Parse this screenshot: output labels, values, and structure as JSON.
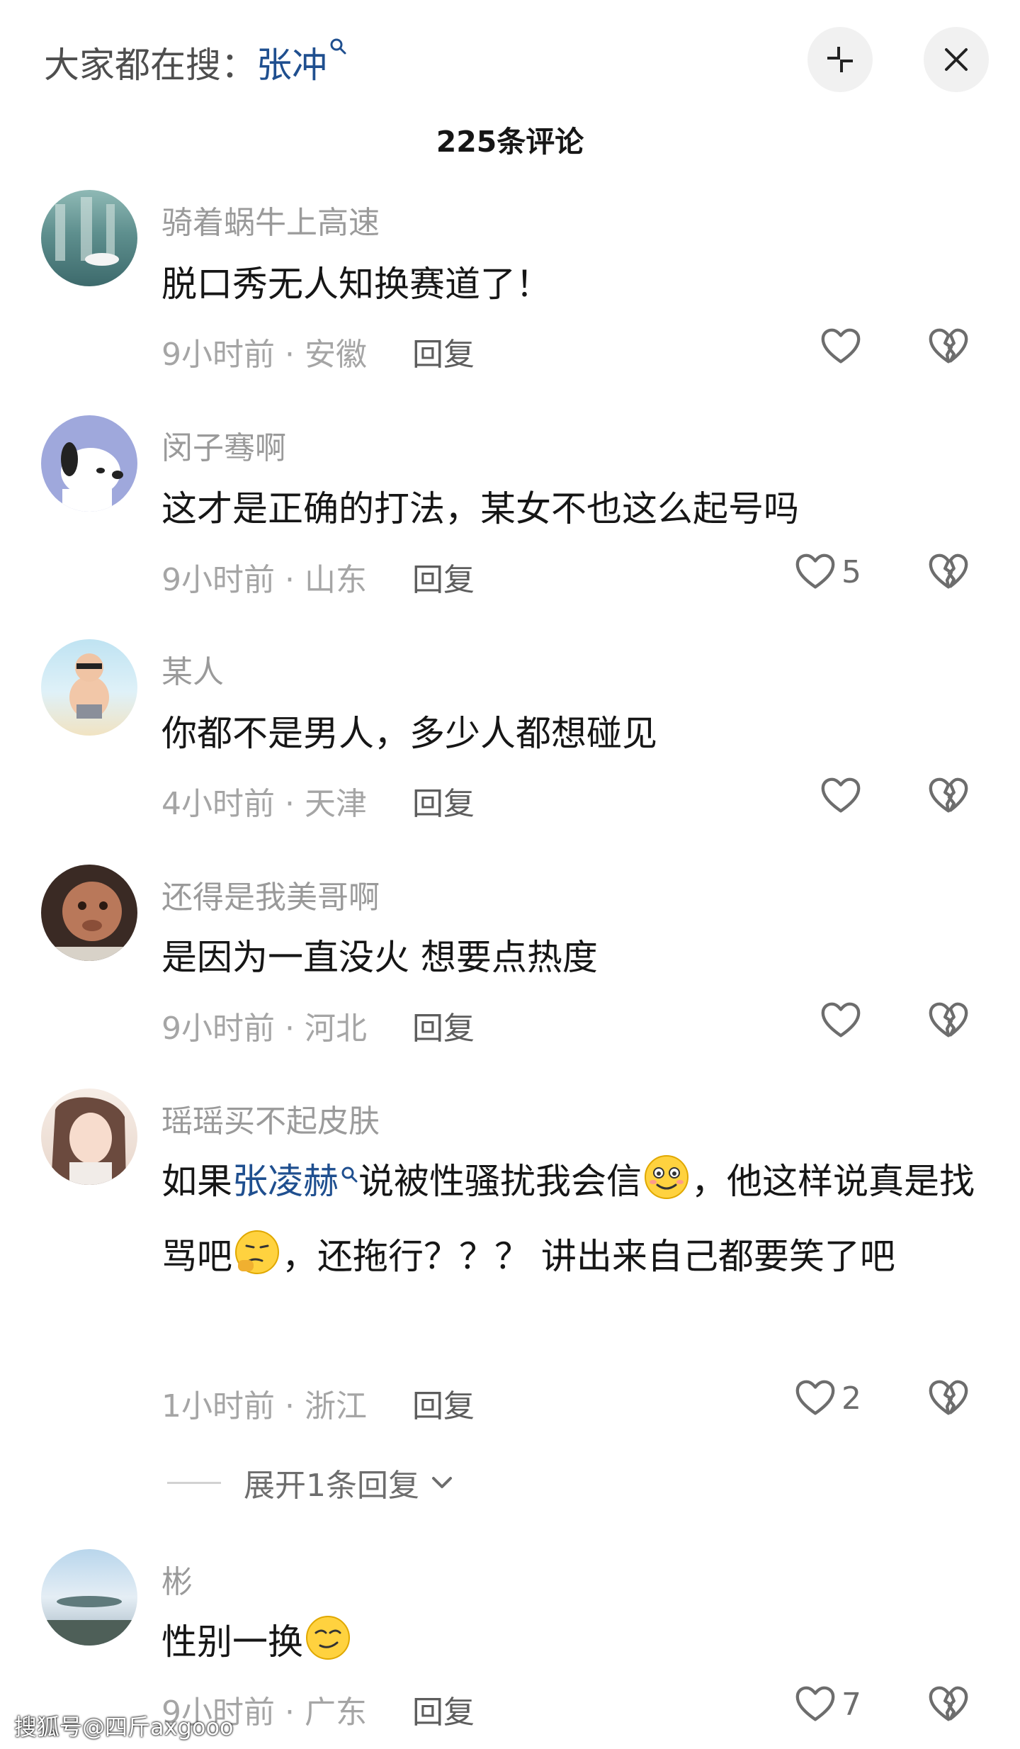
{
  "header": {
    "search_prefix": "大家都在搜：",
    "search_keyword": "张冲",
    "comment_count_title": "225条评论"
  },
  "comments": [
    {
      "user": "骑着蜗牛上高速",
      "text": "脱口秀无人知换赛道了！",
      "time_loc": "9小时前 · 安徽",
      "reply": "回复",
      "likes": ""
    },
    {
      "user": "闵子骞啊",
      "text": "这才是正确的打法，某女不也这么起号吗",
      "time_loc": "9小时前 · 山东",
      "reply": "回复",
      "likes": "5"
    },
    {
      "user": "某人",
      "text": "你都不是男人，多少人都想碰见",
      "time_loc": "4小时前 · 天津",
      "reply": "回复",
      "likes": ""
    },
    {
      "user": "还得是我美哥啊",
      "text": "是因为一直没火  想要点热度",
      "time_loc": "9小时前 · 河北",
      "reply": "回复",
      "likes": ""
    },
    {
      "user": "瑶瑶买不起皮肤",
      "text_a": "如果",
      "text_link": "张凌赫",
      "text_b": "说被性骚扰我会信",
      "text_c": "，他这样说真是找骂吧",
      "text_d": "，还拖行？？？ 讲出来自己都要笑了吧",
      "time_loc": "1小时前 · 浙江",
      "reply": "回复",
      "likes": "2",
      "expand": "展开1条回复"
    },
    {
      "user": "彬",
      "text": "性别一换",
      "time_loc": "9小时前 · 广东",
      "reply": "回复",
      "likes": "7"
    }
  ],
  "watermark": "搜狐号@四斤axgooo",
  "icons": [
    "search-keyword-icon",
    "collapse-icon",
    "close-icon",
    "heart-icon",
    "broken-heart-icon",
    "chevron-down-icon",
    "smile-emoji",
    "thinking-emoji",
    "smirk-emoji"
  ]
}
